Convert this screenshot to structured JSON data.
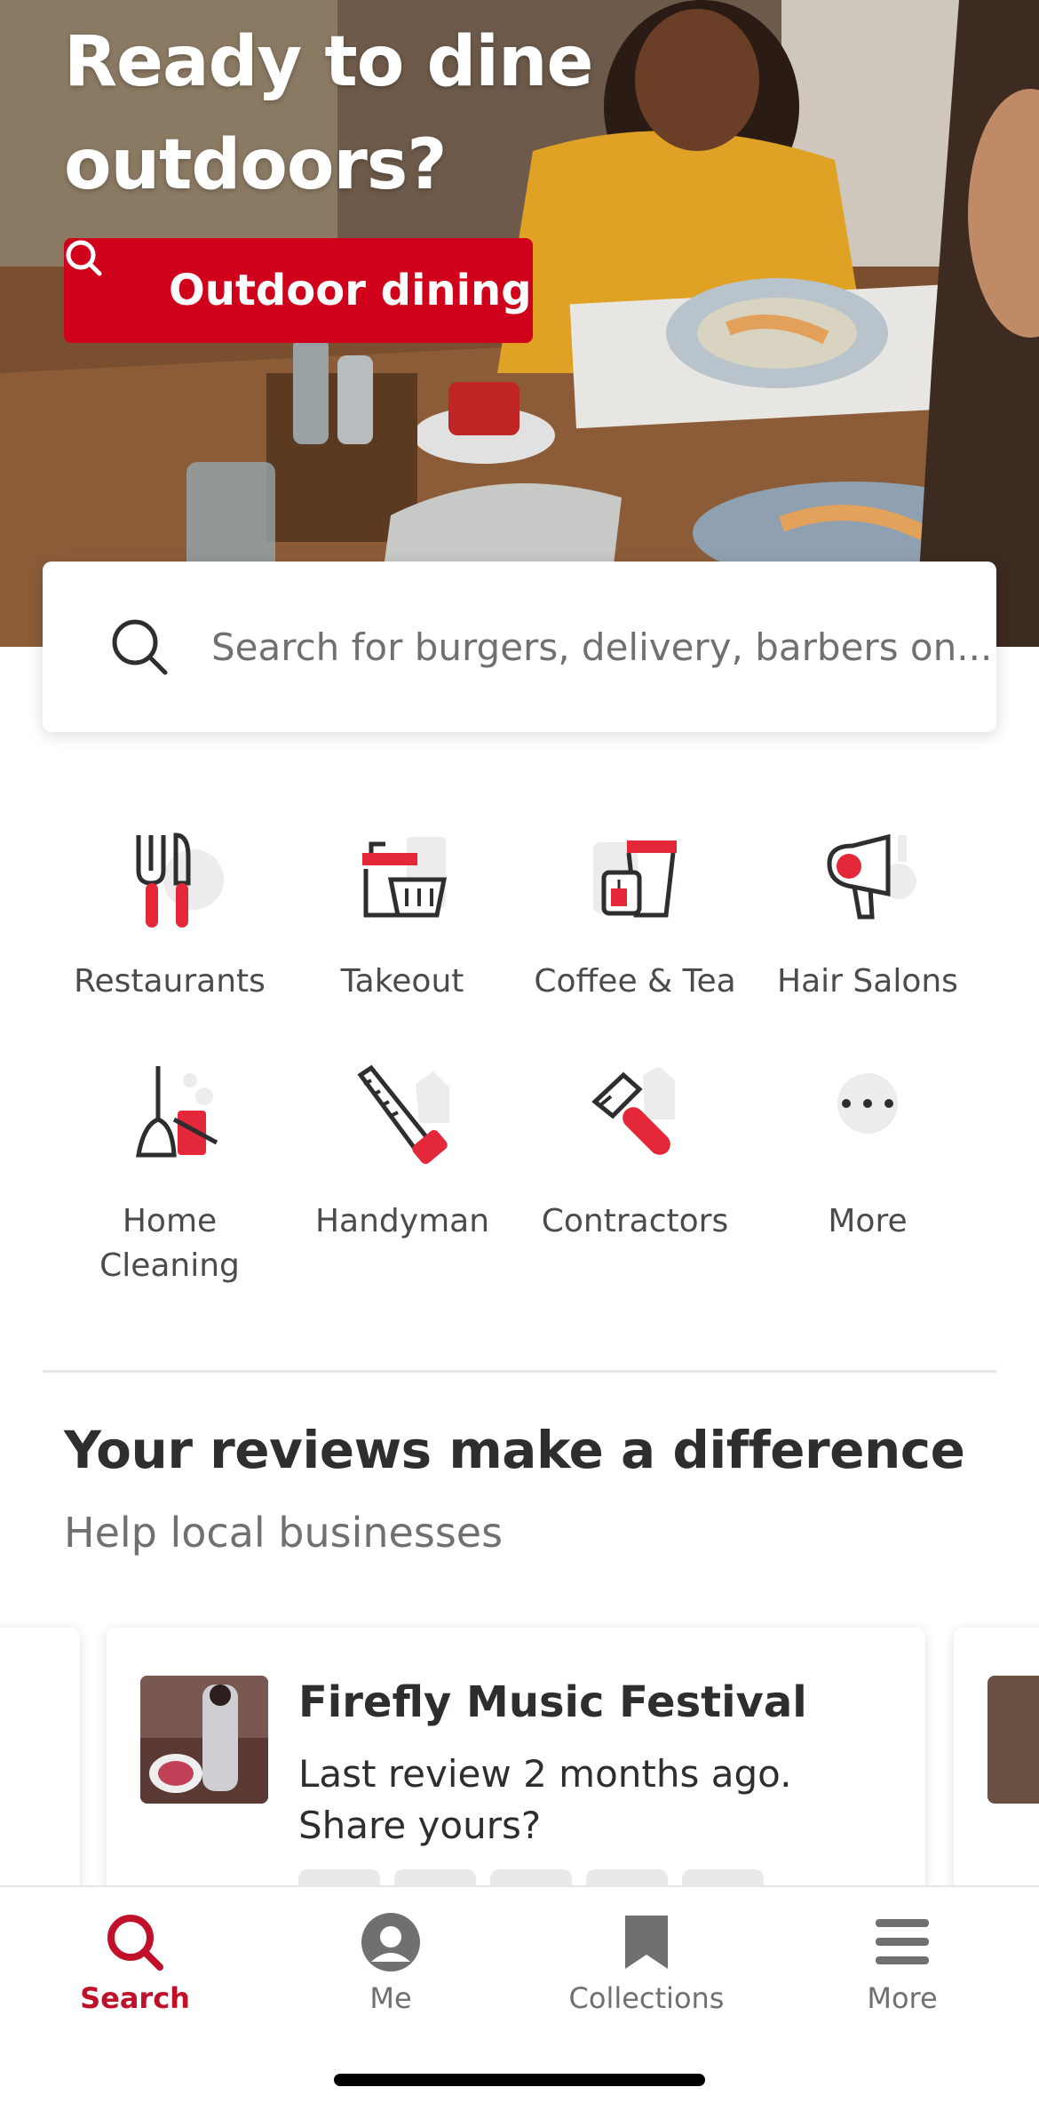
{
  "hero": {
    "title": "Ready to dine outdoors?",
    "button_label": "Outdoor dining"
  },
  "search": {
    "placeholder": "Search for burgers, delivery, barbers on..."
  },
  "categories": [
    {
      "label": "Restaurants",
      "icon": "fork-knife-icon"
    },
    {
      "label": "Takeout",
      "icon": "takeout-bag-icon"
    },
    {
      "label": "Coffee & Tea",
      "icon": "coffee-cup-icon"
    },
    {
      "label": "Hair Salons",
      "icon": "hair-dryer-icon"
    },
    {
      "label": "Home Cleaning",
      "icon": "broom-icon"
    },
    {
      "label": "Handyman",
      "icon": "saw-icon"
    },
    {
      "label": "Contractors",
      "icon": "hammer-icon"
    },
    {
      "label": "More",
      "icon": "more-dots-icon"
    }
  ],
  "reviews": {
    "title": "Your reviews make a difference",
    "subtitle": "Help local businesses",
    "card": {
      "name": "Firefly Music Festival",
      "description": "Last review 2 months ago. Share yours?"
    }
  },
  "nav": [
    {
      "label": "Search",
      "icon": "search-icon",
      "active": true
    },
    {
      "label": "Me",
      "icon": "profile-icon",
      "active": false
    },
    {
      "label": "Collections",
      "icon": "bookmark-icon",
      "active": false
    },
    {
      "label": "More",
      "icon": "menu-icon",
      "active": false
    }
  ],
  "colors": {
    "brand_red": "#d0021b",
    "active_nav": "#c0102a",
    "text_dark": "#2d2e2f",
    "text_muted": "#6e7072"
  }
}
